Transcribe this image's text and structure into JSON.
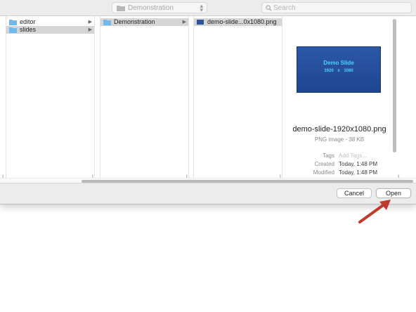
{
  "toolbar": {
    "location": "Demonstration",
    "search_placeholder": "Search"
  },
  "columns": {
    "col1": [
      {
        "label": "editor",
        "type": "folder",
        "selected": false
      },
      {
        "label": "slides",
        "type": "folder",
        "selected": true
      }
    ],
    "col2": [
      {
        "label": "Demonstration",
        "type": "folder",
        "selected": true
      }
    ],
    "col3": [
      {
        "label": "demo-slide...0x1080.png",
        "type": "file",
        "selected": true
      }
    ]
  },
  "preview": {
    "thumbnail_title": "Demo Slide",
    "thumbnail_size": "1920 x 1080",
    "filename": "demo-slide-1920x1080.png",
    "kind": "PNG image - 38 KB",
    "tags_label": "Tags",
    "tags_placeholder": "Add Tags...",
    "created_label": "Created",
    "created_value": "Today, 1:48 PM",
    "modified_label": "Modified",
    "modified_value": "Today, 1:48 PM"
  },
  "footer": {
    "cancel_label": "Cancel",
    "open_label": "Open"
  },
  "colors": {
    "folder": "#6fb8f0",
    "thumbnail_bg": "#2a55a3",
    "thumbnail_text": "#4fd3ff",
    "arrow": "#c0392b"
  }
}
